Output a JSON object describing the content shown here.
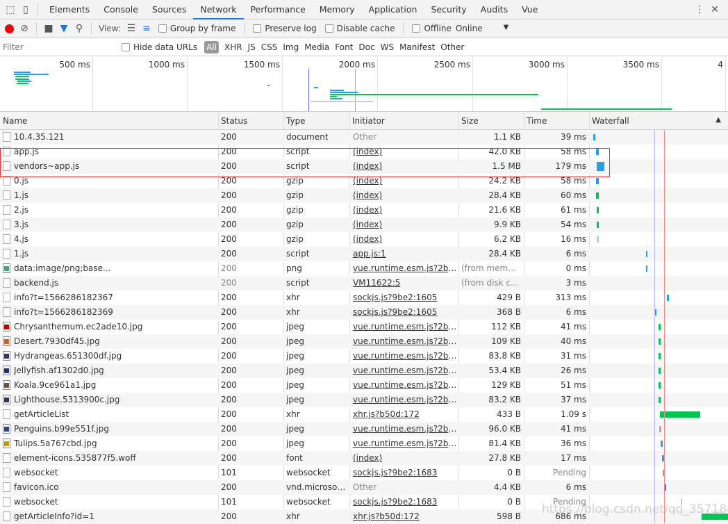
{
  "tabs": [
    "Elements",
    "Console",
    "Sources",
    "Network",
    "Performance",
    "Memory",
    "Application",
    "Security",
    "Audits",
    "Vue"
  ],
  "active_tab": "Network",
  "toolbar": {
    "view_label": "View:",
    "group_by_frame": "Group by frame",
    "preserve_log": "Preserve log",
    "disable_cache": "Disable cache",
    "offline": "Offline",
    "throttle": "Online"
  },
  "filter": {
    "placeholder": "Filter",
    "hide_data_urls": "Hide data URLs",
    "types": [
      "All",
      "XHR",
      "JS",
      "CSS",
      "Img",
      "Media",
      "Font",
      "Doc",
      "WS",
      "Manifest",
      "Other"
    ]
  },
  "overview": {
    "ticks": [
      "500 ms",
      "1000 ms",
      "1500 ms",
      "2000 ms",
      "2500 ms",
      "3000 ms",
      "3500 ms",
      "4"
    ]
  },
  "columns": [
    "Name",
    "Status",
    "Type",
    "Initiator",
    "Size",
    "Time",
    "Waterfall"
  ],
  "rows": [
    {
      "name": "10.4.35.121",
      "status": "200",
      "type": "document",
      "initiator": "Other",
      "size": "1.1 KB",
      "time": "39 ms"
    },
    {
      "name": "app.js",
      "status": "200",
      "type": "script",
      "initiator": "(index)",
      "size": "42.0 KB",
      "time": "58 ms"
    },
    {
      "name": "vendors~app.js",
      "status": "200",
      "type": "script",
      "initiator": "(index)",
      "size": "1.5 MB",
      "time": "179 ms"
    },
    {
      "name": "0.js",
      "status": "200",
      "type": "gzip",
      "initiator": "(index)",
      "size": "24.2 KB",
      "time": "58 ms"
    },
    {
      "name": "1.js",
      "status": "200",
      "type": "gzip",
      "initiator": "(index)",
      "size": "28.4 KB",
      "time": "60 ms"
    },
    {
      "name": "2.js",
      "status": "200",
      "type": "gzip",
      "initiator": "(index)",
      "size": "21.6 KB",
      "time": "61 ms"
    },
    {
      "name": "3.js",
      "status": "200",
      "type": "gzip",
      "initiator": "(index)",
      "size": "9.9 KB",
      "time": "54 ms"
    },
    {
      "name": "4.js",
      "status": "200",
      "type": "gzip",
      "initiator": "(index)",
      "size": "6.2 KB",
      "time": "16 ms"
    },
    {
      "name": "1.js",
      "status": "200",
      "type": "script",
      "initiator": "app.js:1",
      "size": "28.4 KB",
      "time": "6 ms"
    },
    {
      "name": "data:image/png;base...",
      "status": "200",
      "type": "png",
      "initiator": "vue.runtime.esm.js?2b0e:6...",
      "size": "(from memory...",
      "time": "0 ms"
    },
    {
      "name": "backend.js",
      "status": "200",
      "type": "script",
      "initiator": "VM11622:5",
      "size": "(from disk cac...",
      "time": "3 ms"
    },
    {
      "name": "info?t=1566286182367",
      "status": "200",
      "type": "xhr",
      "initiator": "sockjs.js?9be2:1605",
      "size": "429 B",
      "time": "313 ms"
    },
    {
      "name": "info?t=1566286182369",
      "status": "200",
      "type": "xhr",
      "initiator": "sockjs.js?9be2:1605",
      "size": "368 B",
      "time": "6 ms"
    },
    {
      "name": "Chrysanthemum.ec2ade10.jpg",
      "status": "200",
      "type": "jpeg",
      "initiator": "vue.runtime.esm.js?2b0e:6...",
      "size": "112 KB",
      "time": "41 ms"
    },
    {
      "name": "Desert.7930df45.jpg",
      "status": "200",
      "type": "jpeg",
      "initiator": "vue.runtime.esm.js?2b0e:6...",
      "size": "109 KB",
      "time": "40 ms"
    },
    {
      "name": "Hydrangeas.651300df.jpg",
      "status": "200",
      "type": "jpeg",
      "initiator": "vue.runtime.esm.js?2b0e:6...",
      "size": "83.8 KB",
      "time": "31 ms"
    },
    {
      "name": "Jellyfish.af1302d0.jpg",
      "status": "200",
      "type": "jpeg",
      "initiator": "vue.runtime.esm.js?2b0e:6...",
      "size": "53.4 KB",
      "time": "26 ms"
    },
    {
      "name": "Koala.9ce961a1.jpg",
      "status": "200",
      "type": "jpeg",
      "initiator": "vue.runtime.esm.js?2b0e:6...",
      "size": "129 KB",
      "time": "51 ms"
    },
    {
      "name": "Lighthouse.5313900c.jpg",
      "status": "200",
      "type": "jpeg",
      "initiator": "vue.runtime.esm.js?2b0e:6...",
      "size": "83.2 KB",
      "time": "37 ms"
    },
    {
      "name": "getArticleList",
      "status": "200",
      "type": "xhr",
      "initiator": "xhr.js?b50d:172",
      "size": "433 B",
      "time": "1.09 s"
    },
    {
      "name": "Penguins.b99e551f.jpg",
      "status": "200",
      "type": "jpeg",
      "initiator": "vue.runtime.esm.js?2b0e:6...",
      "size": "96.0 KB",
      "time": "41 ms"
    },
    {
      "name": "Tulips.5a767cbd.jpg",
      "status": "200",
      "type": "jpeg",
      "initiator": "vue.runtime.esm.js?2b0e:6...",
      "size": "81.4 KB",
      "time": "36 ms"
    },
    {
      "name": "element-icons.535877f5.woff",
      "status": "200",
      "type": "font",
      "initiator": "(index)",
      "size": "27.8 KB",
      "time": "17 ms"
    },
    {
      "name": "websocket",
      "status": "101",
      "type": "websocket",
      "initiator": "sockjs.js?9be2:1683",
      "size": "0 B",
      "time": "Pending"
    },
    {
      "name": "favicon.ico",
      "status": "200",
      "type": "vnd.microsoft....",
      "initiator": "Other",
      "size": "4.4 KB",
      "time": "6 ms"
    },
    {
      "name": "websocket",
      "status": "101",
      "type": "websocket",
      "initiator": "sockjs.js?9be2:1683",
      "size": "0 B",
      "time": "Pending"
    },
    {
      "name": "getArticleInfo?id=1",
      "status": "200",
      "type": "xhr",
      "initiator": "xhr.js?b50d:172",
      "size": "598 B",
      "time": "686 ms"
    }
  ],
  "watermark": "https://blog.csdn.net/qq_35718410",
  "colors": {
    "accent": "#1a73e8",
    "highlight_box": "#e53935",
    "bar_blue": "#1ea1f2",
    "bar_green": "#00c853",
    "record": "#e00"
  }
}
